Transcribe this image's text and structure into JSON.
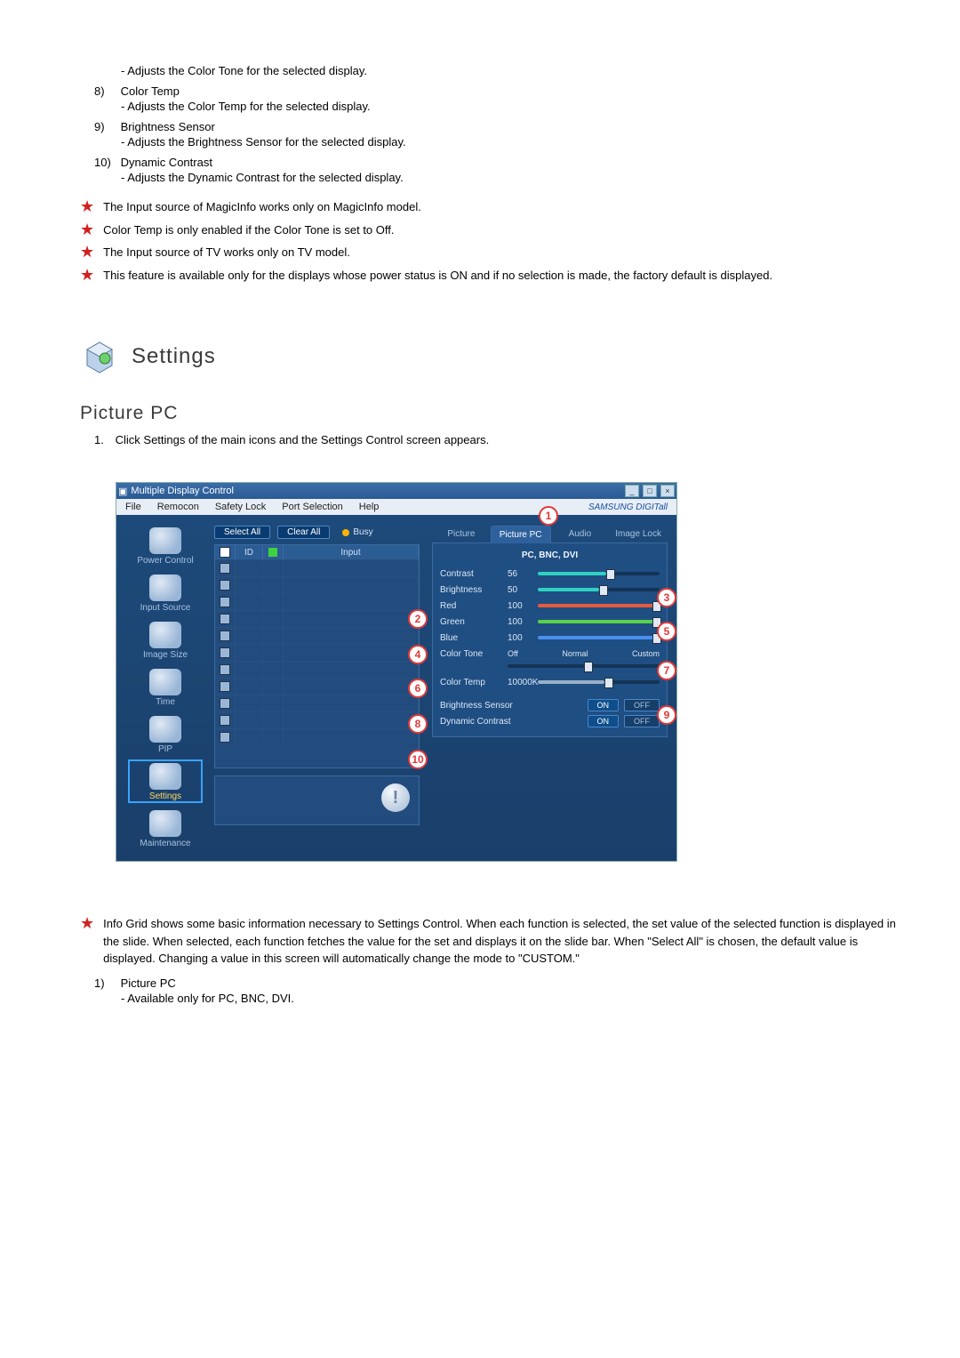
{
  "top_items": [
    {
      "desc": "Adjusts the Color Tone for the selected display."
    },
    {
      "num": "8)",
      "title": "Color Temp",
      "desc": "Adjusts the Color Temp for the selected display."
    },
    {
      "num": "9)",
      "title": "Brightness Sensor",
      "desc": "Adjusts the Brightness Sensor for the selected display."
    },
    {
      "num": "10)",
      "title": "Dynamic Contrast",
      "desc": "Adjusts the Dynamic Contrast for the selected display."
    }
  ],
  "star_notes": [
    "The Input source of MagicInfo works only on MagicInfo model.",
    "Color Temp is only enabled if the Color Tone is set to Off.",
    "The Input source of TV works only on TV model.",
    "This feature is available only for the displays whose power status is ON and if no selection is made, the factory default is displayed."
  ],
  "section_title": "Settings",
  "subsection_title": "Picture PC",
  "step1": {
    "num": "1.",
    "text": "Click Settings of the main icons and the Settings Control screen appears."
  },
  "bottom_star": "Info Grid shows some basic information necessary to Settings Control. When each function is selected, the set value of the selected function is displayed in the slide. When selected, each function fetches the value for the set and displays it on the slide bar. When \"Select All\" is chosen, the default value is displayed. Changing a value in this screen will automatically change the mode to \"CUSTOM.\"",
  "bottom_items": [
    {
      "num": "1)",
      "title": "Picture PC",
      "desc": "Available only for PC, BNC, DVI."
    }
  ],
  "app": {
    "title": "Multiple Display Control",
    "menus": [
      "File",
      "Remocon",
      "Safety Lock",
      "Port Selection",
      "Help"
    ],
    "brand": "SAMSUNG DIGITall",
    "sidebar": [
      {
        "label": "Power Control"
      },
      {
        "label": "Input Source"
      },
      {
        "label": "Image Size"
      },
      {
        "label": "Time"
      },
      {
        "label": "PIP"
      },
      {
        "label": "Settings",
        "selected": true
      },
      {
        "label": "Maintenance"
      }
    ],
    "buttons": {
      "select_all": "Select All",
      "clear_all": "Clear All",
      "busy": "Busy"
    },
    "grid_headers": {
      "chk": "",
      "id": "ID",
      "flag": "",
      "input": "Input"
    },
    "tabs": [
      "Picture",
      "Picture PC",
      "Audio",
      "Image Lock"
    ],
    "active_tab": "Picture PC",
    "panel_title": "PC, BNC, DVI",
    "rows": {
      "contrast": {
        "label": "Contrast",
        "value": "56",
        "pct": 56,
        "color": "teal"
      },
      "brightness": {
        "label": "Brightness",
        "value": "50",
        "pct": 50,
        "color": "teal"
      },
      "red": {
        "label": "Red",
        "value": "100",
        "pct": 100,
        "color": "red"
      },
      "green": {
        "label": "Green",
        "value": "100",
        "pct": 100,
        "color": "green"
      },
      "blue": {
        "label": "Blue",
        "value": "100",
        "pct": 100,
        "color": "blue"
      },
      "color_tone": {
        "label": "Color Tone",
        "opts": [
          "Off",
          "Normal",
          "Custom"
        ],
        "sel": 1
      },
      "color_temp": {
        "label": "Color Temp",
        "value": "10000K",
        "pct": 55,
        "color": "gray"
      },
      "bsensor": {
        "label": "Brightness Sensor",
        "on": "ON",
        "off": "OFF"
      },
      "dcontrast": {
        "label": "Dynamic Contrast",
        "on": "ON",
        "off": "OFF"
      }
    },
    "callouts": [
      "1",
      "2",
      "3",
      "4",
      "5",
      "6",
      "7",
      "8",
      "9",
      "10"
    ]
  }
}
